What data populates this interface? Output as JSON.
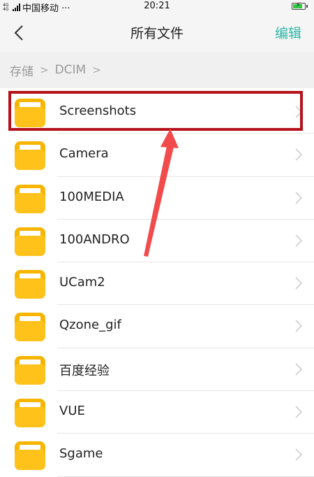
{
  "status_bar": {
    "network": "4G 4G",
    "carrier": "中国移动 ···",
    "time": "20:21"
  },
  "header": {
    "title": "所有文件",
    "edit_label": "编辑"
  },
  "breadcrumb": {
    "items": [
      "存储",
      "DCIM"
    ]
  },
  "folders": [
    {
      "name": "Screenshots"
    },
    {
      "name": "Camera"
    },
    {
      "name": "100MEDIA"
    },
    {
      "name": "100ANDRO"
    },
    {
      "name": "UCam2"
    },
    {
      "name": "Qzone_gif"
    },
    {
      "name": "百度经验"
    },
    {
      "name": "VUE"
    },
    {
      "name": "Sgame"
    }
  ],
  "colors": {
    "accent": "#2db7a6",
    "folder": "#f7b500",
    "annotation": "#b5121b",
    "arrow": "#f24b4b"
  }
}
